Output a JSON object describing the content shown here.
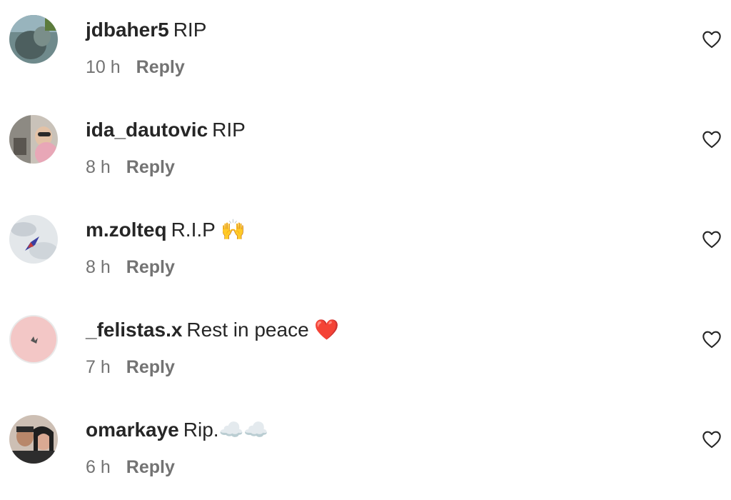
{
  "comments": [
    {
      "username": "jdbaher5",
      "text": "RIP",
      "time": "10 h",
      "reply_label": "Reply",
      "avatar_color": "#5b6e70"
    },
    {
      "username": "ida_dautovic",
      "text": "RIP",
      "time": "8 h",
      "reply_label": "Reply",
      "avatar_color": "#b9b1a9"
    },
    {
      "username": "m.zolteq",
      "text": "R.I.P 🙌",
      "time": "8 h",
      "reply_label": "Reply",
      "avatar_color": "#d7dce0"
    },
    {
      "username": "_felistas.x",
      "text": "Rest in peace ❤️",
      "time": "7 h",
      "reply_label": "Reply",
      "avatar_color": "#f2c5c4"
    },
    {
      "username": "omarkaye",
      "text": "Rip.☁️☁️",
      "time": "6 h",
      "reply_label": "Reply",
      "avatar_color": "#a8948a"
    }
  ],
  "icons": {
    "like": "heart-outline-icon"
  },
  "colors": {
    "text": "#262626",
    "secondary": "#737373"
  }
}
